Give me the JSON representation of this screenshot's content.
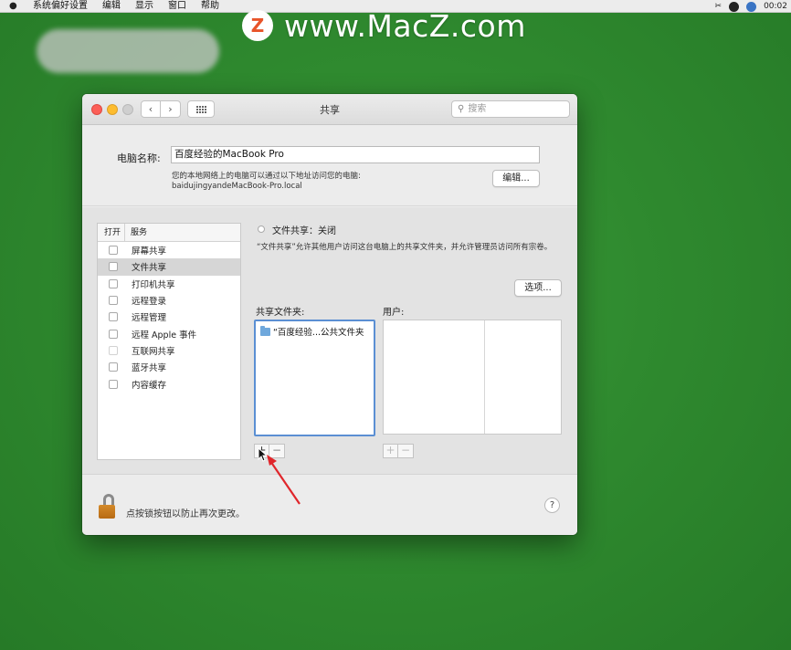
{
  "menubar": {
    "items": [
      "系统偏好设置",
      "编辑",
      "显示",
      "窗口",
      "帮助"
    ],
    "clock": "00:02"
  },
  "watermark": {
    "badge": "Z",
    "text": "www.MacZ.com"
  },
  "window": {
    "title": "共享",
    "search_placeholder": "搜索",
    "nav_back": "‹",
    "nav_forward": "›"
  },
  "computer": {
    "label": "电脑名称:",
    "value": "百度经验的MacBook Pro",
    "note": "您的本地网络上的电脑可以通过以下地址访问您的电脑:",
    "host": "baidujingyandeMacBook-Pro.local",
    "edit_label": "编辑..."
  },
  "services": {
    "col_on": "打开",
    "col_service": "服务",
    "items": [
      {
        "label": "屏幕共享"
      },
      {
        "label": "文件共享"
      },
      {
        "label": "打印机共享"
      },
      {
        "label": "远程登录"
      },
      {
        "label": "远程管理"
      },
      {
        "label": "远程 Apple 事件"
      },
      {
        "label": "互联网共享"
      },
      {
        "label": "蓝牙共享"
      },
      {
        "label": "内容缓存"
      }
    ],
    "selected_index": 1
  },
  "detail": {
    "status": "文件共享：关闭",
    "description": "“文件共享”允许其他用户访问这台电脑上的共享文件夹，并允许管理员访问所有宗卷。",
    "options_label": "选项...",
    "shared_folders_label": "共享文件夹:",
    "users_label": "用户:",
    "shared_folders": [
      "“百度经验...公共文件夹"
    ],
    "plus": "+",
    "minus": "−"
  },
  "footer": {
    "lock_text": "点按锁按钮以防止再次更改。",
    "help": "?"
  },
  "colors": {
    "desktop": "#2f8a2f",
    "selection_blue": "#5b8fd3",
    "arrow_red": "#e0262b"
  }
}
